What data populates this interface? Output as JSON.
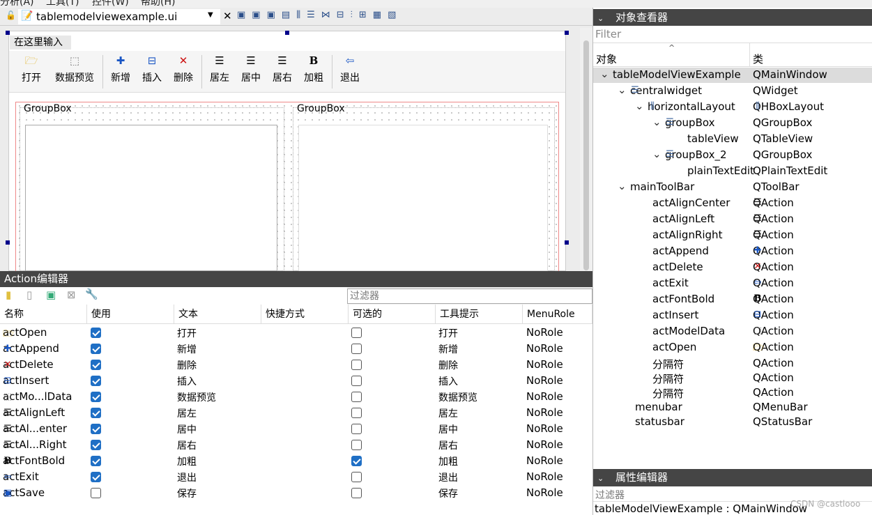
{
  "menubar": {
    "items": [
      "分析(A)",
      "工具(T)",
      "控件(W)",
      "帮助(H)"
    ]
  },
  "file_tab": {
    "title": "tablemodelviewexample.ui"
  },
  "form": {
    "menu_placeholder": "在这里输入",
    "toolbar": [
      {
        "icon": "folder-icon",
        "label": "打开"
      },
      {
        "icon": "model-data-icon",
        "label": "数据预览"
      },
      {
        "icon": "plus-icon",
        "label": "新增"
      },
      {
        "icon": "insert-icon",
        "label": "插入"
      },
      {
        "icon": "delete-icon",
        "label": "删除"
      },
      {
        "icon": "align-left-icon",
        "label": "居左"
      },
      {
        "icon": "align-center-icon",
        "label": "居中"
      },
      {
        "icon": "align-right-icon",
        "label": "居右"
      },
      {
        "icon": "bold-icon",
        "label": "加粗"
      },
      {
        "icon": "exit-icon",
        "label": "退出"
      }
    ],
    "groupbox1": "GroupBox",
    "groupbox2": "GroupBox"
  },
  "action_editor": {
    "title": "Action编辑器",
    "filter_placeholder": "过滤器",
    "columns": [
      "名称",
      "使用",
      "文本",
      "快捷方式",
      "可选的",
      "工具提示",
      "MenuRole"
    ],
    "rows": [
      {
        "icon": "folder-icon",
        "name": "actOpen",
        "used": true,
        "text": "打开",
        "shortcut": "",
        "checkable": false,
        "tooltip": "打开",
        "role": "NoRole"
      },
      {
        "icon": "plus-icon",
        "name": "actAppend",
        "used": true,
        "text": "新增",
        "shortcut": "",
        "checkable": false,
        "tooltip": "新增",
        "role": "NoRole"
      },
      {
        "icon": "delete-icon",
        "name": "actDelete",
        "used": true,
        "text": "删除",
        "shortcut": "",
        "checkable": false,
        "tooltip": "删除",
        "role": "NoRole"
      },
      {
        "icon": "insert-icon",
        "name": "actInsert",
        "used": true,
        "text": "插入",
        "shortcut": "",
        "checkable": false,
        "tooltip": "插入",
        "role": "NoRole"
      },
      {
        "icon": "model-data-icon",
        "name": "actMo...lData",
        "used": true,
        "text": "数据预览",
        "shortcut": "",
        "checkable": false,
        "tooltip": "数据预览",
        "role": "NoRole"
      },
      {
        "icon": "align-left-icon",
        "name": "actAlignLeft",
        "used": true,
        "text": "居左",
        "shortcut": "",
        "checkable": false,
        "tooltip": "居左",
        "role": "NoRole"
      },
      {
        "icon": "align-center-icon",
        "name": "actAl...enter",
        "used": true,
        "text": "居中",
        "shortcut": "",
        "checkable": false,
        "tooltip": "居中",
        "role": "NoRole"
      },
      {
        "icon": "align-right-icon",
        "name": "actAl...Right",
        "used": true,
        "text": "居右",
        "shortcut": "",
        "checkable": false,
        "tooltip": "居右",
        "role": "NoRole"
      },
      {
        "icon": "bold-icon",
        "name": "actFontBold",
        "used": true,
        "text": "加粗",
        "shortcut": "",
        "checkable": true,
        "tooltip": "加粗",
        "role": "NoRole"
      },
      {
        "icon": "exit-icon",
        "name": "actExit",
        "used": true,
        "text": "退出",
        "shortcut": "",
        "checkable": false,
        "tooltip": "退出",
        "role": "NoRole"
      },
      {
        "icon": "save-icon",
        "name": "actSave",
        "used": false,
        "text": "保存",
        "shortcut": "",
        "checkable": false,
        "tooltip": "保存",
        "role": "NoRole"
      }
    ]
  },
  "object_inspector": {
    "title": "对象查看器",
    "filter_placeholder": "Filter",
    "col_object": "对象",
    "col_class": "类",
    "rows": [
      {
        "name": "tableModelViewExample",
        "cls": "QMainWindow",
        "indent": 0,
        "expand": "v",
        "icon": "",
        "cls_icon": "",
        "selected": true
      },
      {
        "name": "centralwidget",
        "cls": "QWidget",
        "indent": 1,
        "expand": "v",
        "icon": "widget-icon",
        "cls_icon": ""
      },
      {
        "name": "horizontalLayout",
        "cls": "QHBoxLayout",
        "indent": 2,
        "expand": "v",
        "icon": "hbox-layout-icon",
        "cls_icon": "hbox-layout-icon"
      },
      {
        "name": "groupBox",
        "cls": "QGroupBox",
        "indent": 3,
        "expand": "v",
        "icon": "widget-icon",
        "cls_icon": ""
      },
      {
        "name": "tableView",
        "cls": "QTableView",
        "indent": 4,
        "expand": "",
        "icon": "",
        "cls_icon": ""
      },
      {
        "name": "groupBox_2",
        "cls": "QGroupBox",
        "indent": 3,
        "expand": "v",
        "icon": "widget-icon",
        "cls_icon": ""
      },
      {
        "name": "plainTextEdit",
        "cls": "QPlainTextEdit",
        "indent": 4,
        "expand": "",
        "icon": "",
        "cls_icon": ""
      },
      {
        "name": "mainToolBar",
        "cls": "QToolBar",
        "indent": 1,
        "expand": "v",
        "icon": "",
        "cls_icon": ""
      },
      {
        "name": "actAlignCenter",
        "cls": "QAction",
        "indent": 2,
        "expand": "",
        "icon": "",
        "cls_icon": "align-center-icon"
      },
      {
        "name": "actAlignLeft",
        "cls": "QAction",
        "indent": 2,
        "expand": "",
        "icon": "",
        "cls_icon": "align-left-icon"
      },
      {
        "name": "actAlignRight",
        "cls": "QAction",
        "indent": 2,
        "expand": "",
        "icon": "",
        "cls_icon": "align-right-icon"
      },
      {
        "name": "actAppend",
        "cls": "QAction",
        "indent": 2,
        "expand": "",
        "icon": "",
        "cls_icon": "plus-icon"
      },
      {
        "name": "actDelete",
        "cls": "QAction",
        "indent": 2,
        "expand": "",
        "icon": "",
        "cls_icon": "delete-icon"
      },
      {
        "name": "actExit",
        "cls": "QAction",
        "indent": 2,
        "expand": "",
        "icon": "",
        "cls_icon": "exit-icon"
      },
      {
        "name": "actFontBold",
        "cls": "QAction",
        "indent": 2,
        "expand": "",
        "icon": "",
        "cls_icon": "bold-icon"
      },
      {
        "name": "actInsert",
        "cls": "QAction",
        "indent": 2,
        "expand": "",
        "icon": "",
        "cls_icon": "insert-icon"
      },
      {
        "name": "actModelData",
        "cls": "QAction",
        "indent": 2,
        "expand": "",
        "icon": "",
        "cls_icon": "model-data-icon"
      },
      {
        "name": "actOpen",
        "cls": "QAction",
        "indent": 2,
        "expand": "",
        "icon": "",
        "cls_icon": "folder-icon"
      },
      {
        "name": "分隔符",
        "cls": "QAction",
        "indent": 2,
        "expand": "",
        "icon": "",
        "cls_icon": ""
      },
      {
        "name": "分隔符",
        "cls": "QAction",
        "indent": 2,
        "expand": "",
        "icon": "",
        "cls_icon": ""
      },
      {
        "name": "分隔符",
        "cls": "QAction",
        "indent": 2,
        "expand": "",
        "icon": "",
        "cls_icon": ""
      },
      {
        "name": "menubar",
        "cls": "QMenuBar",
        "indent": 1,
        "expand": "",
        "icon": "",
        "cls_icon": ""
      },
      {
        "name": "statusbar",
        "cls": "QStatusBar",
        "indent": 1,
        "expand": "",
        "icon": "",
        "cls_icon": ""
      }
    ]
  },
  "property_editor": {
    "title": "属性编辑器",
    "filter_placeholder": "过滤器",
    "current": "tableModelViewExample : QMainWindow"
  },
  "watermark": "CSDN @castlooo",
  "colors": {
    "accent": "#1f6fc5",
    "panel_header": "#454545",
    "selection": "#dcdcdc",
    "delete": "#cc1111",
    "plus": "#1a56c4"
  }
}
